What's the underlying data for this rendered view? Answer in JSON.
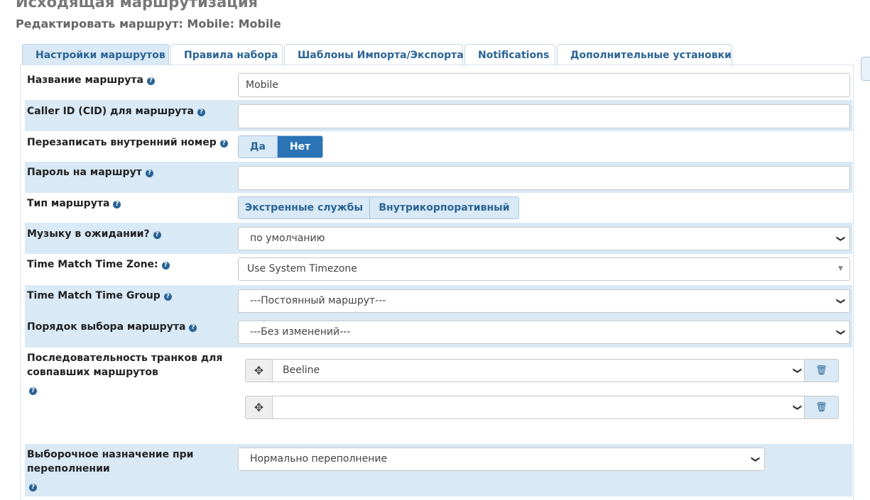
{
  "header": {
    "title": "Исходящая маршрутизация",
    "subtitle": "Редактировать маршрут: Mobile: Mobile"
  },
  "tabs": [
    {
      "label": "Настройки маршрутов",
      "active": true
    },
    {
      "label": "Правила набора",
      "active": false
    },
    {
      "label": "Шаблоны Импорта/Экспорта",
      "active": false
    },
    {
      "label": "Notifications",
      "active": false
    },
    {
      "label": "Дополнительные установки",
      "active": false
    }
  ],
  "form": {
    "route_name": {
      "label": "Название маршрута",
      "value": "Mobile"
    },
    "caller_id": {
      "label": "Caller ID (CID) для маршрута",
      "value": ""
    },
    "override_extension": {
      "label": "Перезаписать внутренний номер",
      "options": [
        "Да",
        "Нет"
      ],
      "selected": "Нет"
    },
    "route_password": {
      "label": "Пароль на маршрут",
      "value": ""
    },
    "route_type": {
      "label": "Тип маршрута",
      "options": [
        "Экстренные службы",
        "Внутрикорпоративный"
      ]
    },
    "music_on_hold": {
      "label": "Музыку в ожидании?",
      "value": "по умолчанию"
    },
    "tm_timezone": {
      "label": "Time Match Time Zone:",
      "value": "Use System Timezone"
    },
    "tm_timegroup": {
      "label": "Time Match Time Group",
      "value": "---Постоянный маршрут---"
    },
    "route_position": {
      "label": "Порядок выбора маршрута",
      "value": "---Без изменений---"
    },
    "trunk_sequence": {
      "label_line1": "Последовательность транков для",
      "label_line2": "совпавших маршрутов",
      "trunks": [
        "Beeline",
        ""
      ]
    },
    "overflow_dest": {
      "label_line1": "Выборочное назначение при",
      "label_line2": "переполнении",
      "value": "Нормально переполнение"
    }
  },
  "icons": {
    "help": "question-circle-icon",
    "drag": "arrows-move-icon",
    "delete": "trash-icon",
    "caret": "chevron-down-icon"
  },
  "colors": {
    "accent": "#2a74b5",
    "link": "#2a6496",
    "row_shade": "#d9e9f5"
  }
}
